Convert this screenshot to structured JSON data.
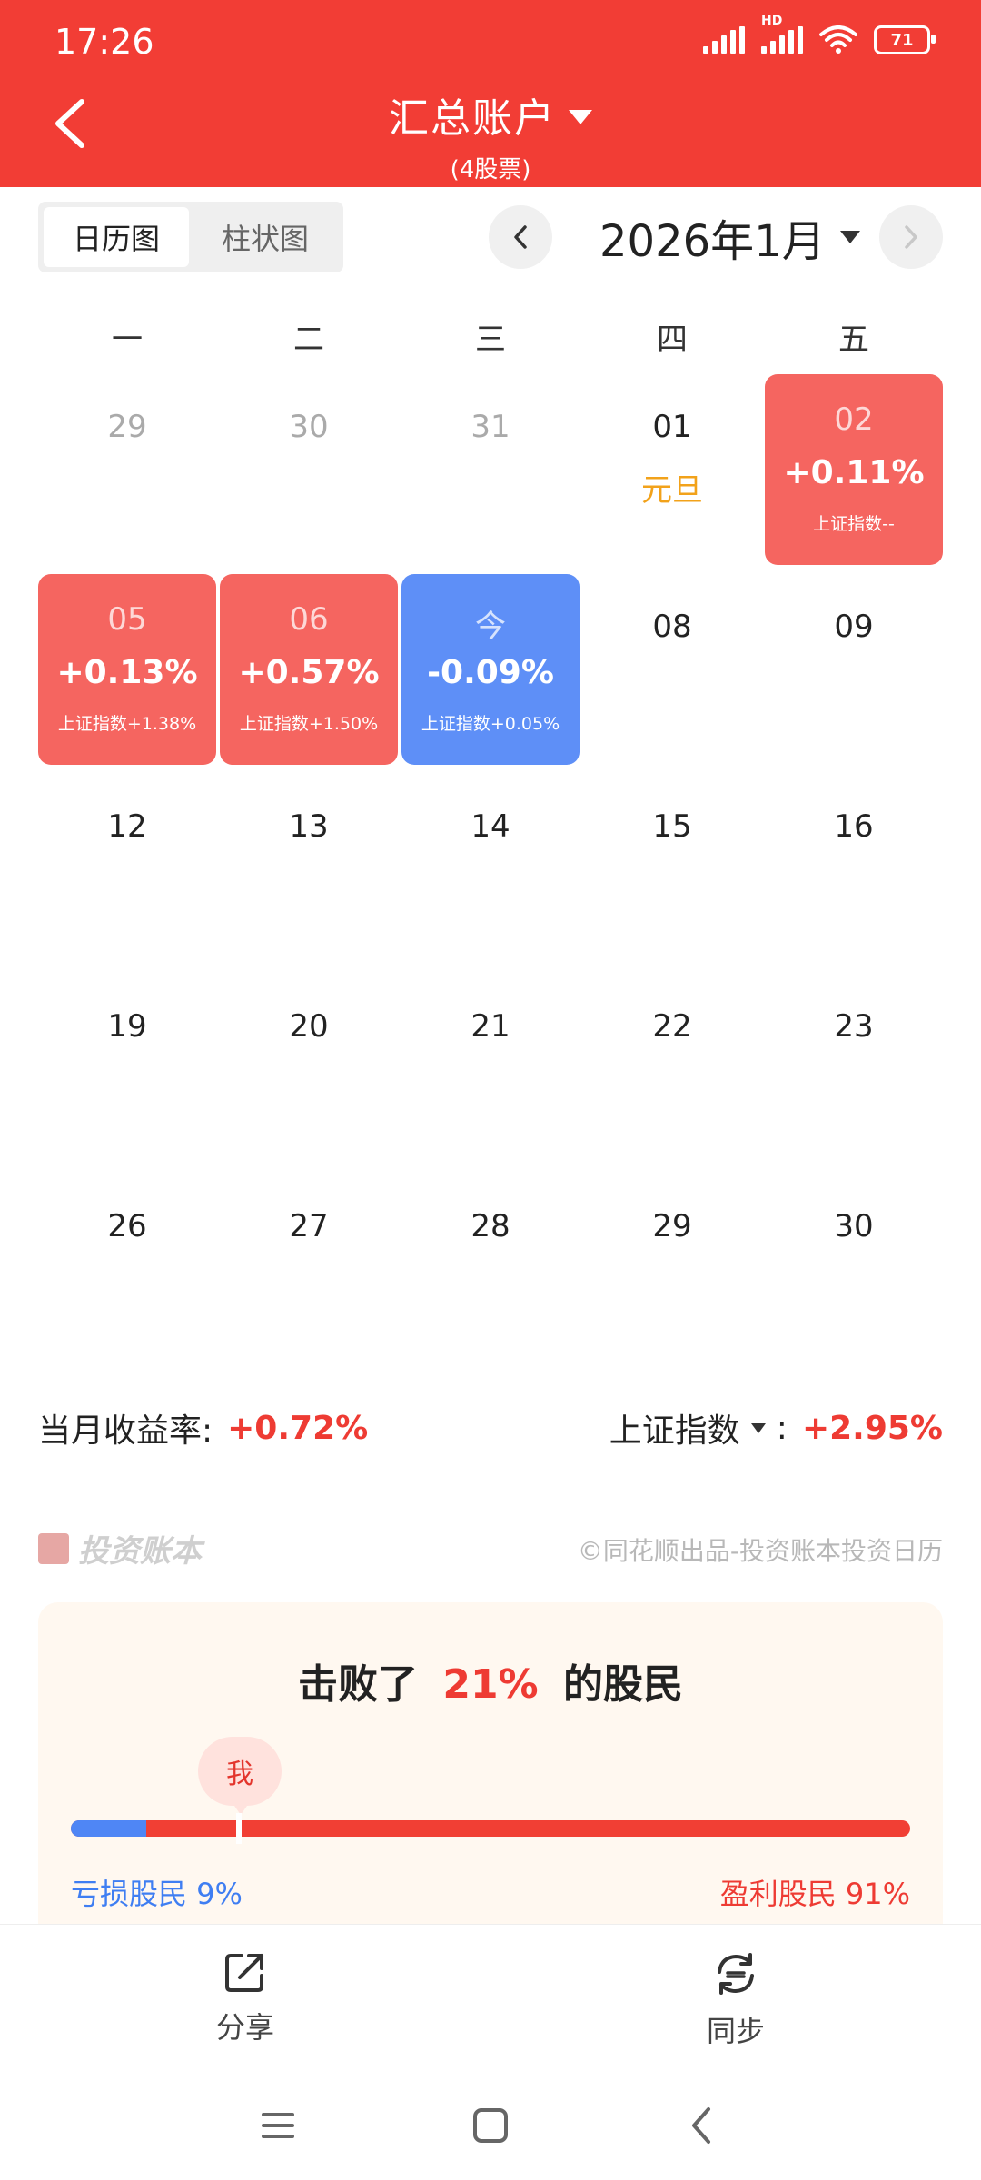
{
  "status_bar": {
    "time": "17:26",
    "network": "HD",
    "battery": "71",
    "icons": [
      "signal-icon",
      "hd-signal-icon",
      "wifi-icon",
      "battery-icon"
    ]
  },
  "header": {
    "title": "汇总账户",
    "subtitle": "(4股票)",
    "back_icon": "chevron-left-icon",
    "title_icon": "caret-down-icon",
    "bg_color": "#f23d35"
  },
  "toolbar": {
    "view_tabs": [
      {
        "label": "日历图",
        "active": true
      },
      {
        "label": "柱状图",
        "active": false
      }
    ],
    "month": "2026年1月",
    "prev_icon": "chevron-left-icon",
    "next_icon": "chevron-right-icon"
  },
  "calendar": {
    "weekdays": [
      "一",
      "二",
      "三",
      "四",
      "五"
    ],
    "weeks": [
      [
        {
          "day": "29",
          "out": true
        },
        {
          "day": "30",
          "out": true
        },
        {
          "day": "31",
          "out": true
        },
        {
          "day": "01",
          "holiday": "元旦"
        },
        {
          "day": "02",
          "pct": "+0.11%",
          "index": "上证指数--",
          "status": "gain"
        }
      ],
      [
        {
          "day": "05",
          "pct": "+0.13%",
          "index": "上证指数+1.38%",
          "status": "gain"
        },
        {
          "day": "06",
          "pct": "+0.57%",
          "index": "上证指数+1.50%",
          "status": "gain"
        },
        {
          "day": "今",
          "pct": "-0.09%",
          "index": "上证指数+0.05%",
          "status": "loss"
        },
        {
          "day": "08"
        },
        {
          "day": "09"
        }
      ],
      [
        {
          "day": "12"
        },
        {
          "day": "13"
        },
        {
          "day": "14"
        },
        {
          "day": "15"
        },
        {
          "day": "16"
        }
      ],
      [
        {
          "day": "19"
        },
        {
          "day": "20"
        },
        {
          "day": "21"
        },
        {
          "day": "22"
        },
        {
          "day": "23"
        }
      ],
      [
        {
          "day": "26"
        },
        {
          "day": "27"
        },
        {
          "day": "28"
        },
        {
          "day": "29"
        },
        {
          "day": "30"
        }
      ]
    ],
    "colors": {
      "gain": "#f56560",
      "loss": "#5e8ff7",
      "holiday": "#f2a21a"
    }
  },
  "summary": {
    "month_return_label": "当月收益率:",
    "month_return_value": "+0.72%",
    "index_label": "上证指数",
    "index_separator": ":",
    "index_value": "+2.95%"
  },
  "branding": {
    "logo_text": "投资账本",
    "credit": "©同花顺出品-投资账本投资日历"
  },
  "beat_card": {
    "prefix": "击败了",
    "percent": "21%",
    "suffix": "的股民",
    "me_label": "我",
    "loss_label": "亏损股民 9%",
    "win_label": "盈利股民 91%",
    "loss_fraction": 0.09,
    "me_fraction": 0.21
  },
  "bottom_bar": {
    "share_label": "分享",
    "sync_label": "同步",
    "share_icon": "share-icon",
    "sync_icon": "sync-icon"
  },
  "system_nav": [
    "menu-icon",
    "home-icon",
    "back-icon"
  ]
}
